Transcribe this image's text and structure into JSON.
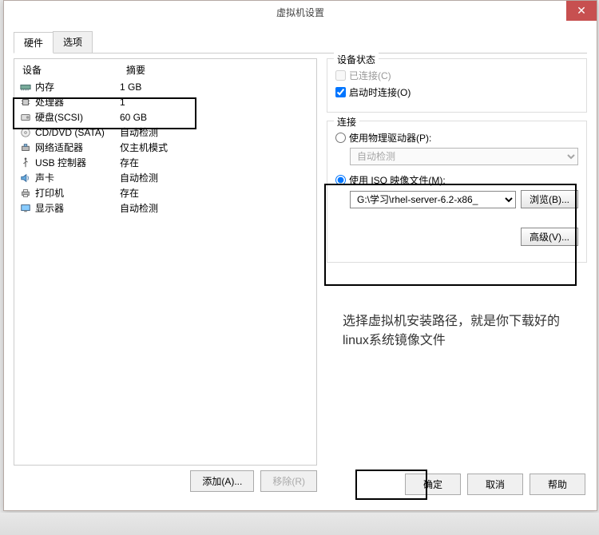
{
  "title": "虚拟机设置",
  "tabs": {
    "hardware": "硬件",
    "options": "选项"
  },
  "headers": {
    "device": "设备",
    "summary": "摘要"
  },
  "devices": [
    {
      "name": "内存",
      "summary": "1 GB",
      "icon": "memory"
    },
    {
      "name": "处理器",
      "summary": "1",
      "icon": "cpu"
    },
    {
      "name": "硬盘(SCSI)",
      "summary": "60 GB",
      "icon": "disk"
    },
    {
      "name": "CD/DVD (SATA)",
      "summary": "自动检测",
      "icon": "cd"
    },
    {
      "name": "网络适配器",
      "summary": "仅主机模式",
      "icon": "network"
    },
    {
      "name": "USB 控制器",
      "summary": "存在",
      "icon": "usb"
    },
    {
      "name": "声卡",
      "summary": "自动检测",
      "icon": "sound"
    },
    {
      "name": "打印机",
      "summary": "存在",
      "icon": "printer"
    },
    {
      "name": "显示器",
      "summary": "自动检测",
      "icon": "display"
    }
  ],
  "leftButtons": {
    "add": "添加(A)...",
    "remove": "移除(R)"
  },
  "deviceStatus": {
    "label": "设备状态",
    "connected": "已连接(C)",
    "connectOnPower": "启动时连接(O)"
  },
  "connection": {
    "label": "连接",
    "physical": "使用物理驱动器(P):",
    "autoDetect": "自动检测",
    "useIso": "使用 ISO 映像文件(M):",
    "isoPath": "G:\\学习\\rhel-server-6.2-x86_",
    "browse": "浏览(B)...",
    "advanced": "高级(V)..."
  },
  "annotation": "选择虚拟机安装路径，就是你下载好的linux系统镜像文件",
  "footer": {
    "ok": "确定",
    "cancel": "取消",
    "help": "帮助"
  }
}
